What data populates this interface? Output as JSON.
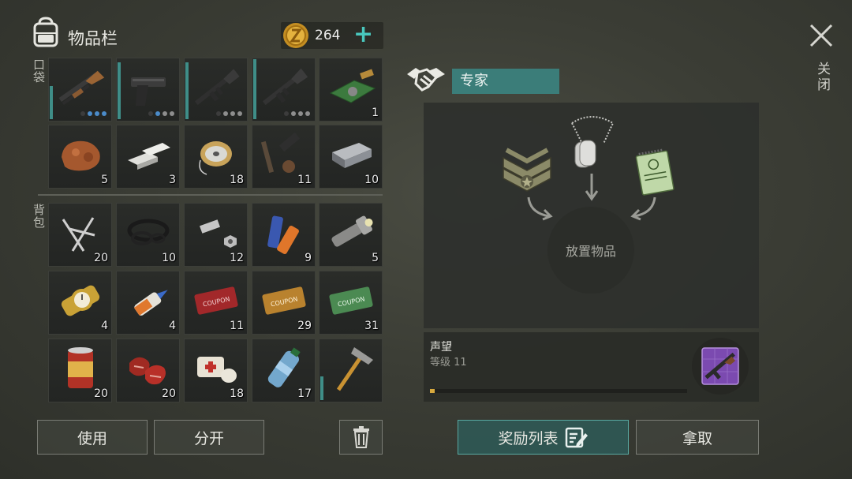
{
  "header": {
    "title": "物品栏",
    "currency_value": "264",
    "add_label": "+"
  },
  "sections": {
    "pocket_label": "口袋",
    "backpack_label": "背包"
  },
  "pocket": [
    {
      "name": "pump-shotgun-icon",
      "durability": 0.55,
      "dots": [
        "d",
        "b",
        "b",
        "b"
      ]
    },
    {
      "name": "pistol-icon",
      "durability": 0.95,
      "dots": [
        "d",
        "b",
        "n",
        "n"
      ]
    },
    {
      "name": "assault-rifle-icon",
      "durability": 0.95,
      "dots": [
        "d",
        "n",
        "n",
        "n"
      ]
    },
    {
      "name": "assault-rifle-2-icon",
      "durability": 1.0,
      "dots": [
        "d",
        "n",
        "n",
        "n"
      ]
    },
    {
      "name": "circuit-board-icon",
      "count": "1"
    },
    {
      "name": "copper-ore-icon",
      "count": "5"
    },
    {
      "name": "silver-bars-icon",
      "count": "3"
    },
    {
      "name": "wire-spool-icon",
      "count": "18"
    },
    {
      "name": "weapon-parts-icon",
      "count": "11"
    },
    {
      "name": "steel-ingot-icon",
      "count": "10"
    }
  ],
  "backpack": [
    {
      "name": "nails-icon",
      "count": "20"
    },
    {
      "name": "rubber-rings-icon",
      "count": "10"
    },
    {
      "name": "bolts-icon",
      "count": "12"
    },
    {
      "name": "batteries-icon",
      "count": "9"
    },
    {
      "name": "flashlight-icon",
      "count": "5"
    },
    {
      "name": "wristwatch-icon",
      "count": "4"
    },
    {
      "name": "glue-icon",
      "count": "4"
    },
    {
      "name": "combat-gear-coupon-icon",
      "count": "11"
    },
    {
      "name": "survival-kit-coupon-icon",
      "count": "29"
    },
    {
      "name": "ration-coupon-icon",
      "count": "31"
    },
    {
      "name": "canned-food-icon",
      "count": "20"
    },
    {
      "name": "raw-meat-icon",
      "count": "20"
    },
    {
      "name": "bandage-icon",
      "count": "18"
    },
    {
      "name": "water-bottle-icon",
      "count": "17"
    },
    {
      "name": "hammer-icon",
      "durability": 0.4
    }
  ],
  "buttons": {
    "use": "使用",
    "split": "分开",
    "rewards": "奖励列表",
    "take": "拿取"
  },
  "trader": {
    "name": "专家",
    "drop_label": "放置物品",
    "reputation_title": "声望",
    "level_text": "等级 11",
    "progress": 0.015,
    "offer_items": [
      "sergeant-badge-icon",
      "dog-tags-icon",
      "notebook-icon"
    ],
    "reward_item": "rifle-blueprint-icon"
  },
  "close_label": "关闭",
  "colors": {
    "accent": "#49c7bd",
    "trader_tag": "#3b7d79",
    "progress": "#d7a93e"
  }
}
